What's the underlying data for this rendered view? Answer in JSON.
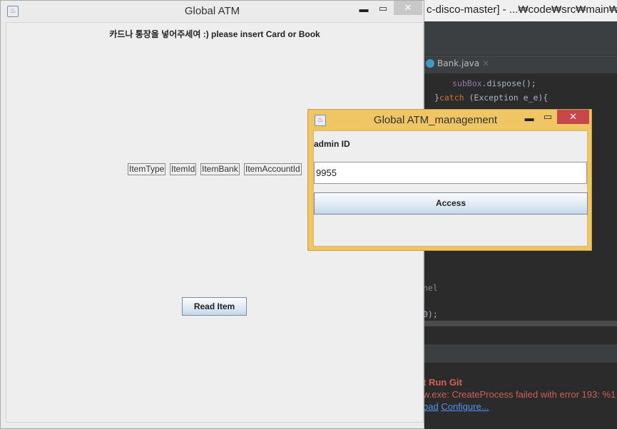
{
  "ide": {
    "title": "c-disco-master] - ...₩code₩src₩main₩ja",
    "tab": "Bank.java",
    "code": [
      {
        "a": "subBox",
        "b": ".dispose();"
      },
      {
        "a": "}",
        "b": "catch",
        "c": " (Exception e_e){"
      }
    ],
    "code_fragment_1": "nel",
    "code_fragment_2": "0);",
    "error_title": "t Run Git",
    "error_msg": "w.exe: CreateProcess failed with error 193: %1",
    "link_1": "oad",
    "link_2": "Configure..."
  },
  "main_window": {
    "title": "Global ATM",
    "prompt": "카드나 통장을 넣어주세여 :) please insert Card or Book",
    "labels": [
      "ItemType",
      "ItemId",
      "ItemBank",
      "ItemAccountId"
    ],
    "read_button": "Read Item"
  },
  "dialog": {
    "title": "Global ATM_management",
    "label": "admin ID",
    "input_value": "9955",
    "access_button": "Access"
  },
  "colors": {
    "dialog_frame": "#f0c563",
    "close_active": "#c7474a"
  }
}
